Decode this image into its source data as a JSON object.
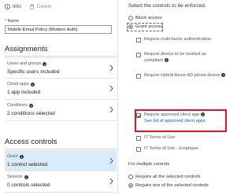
{
  "toolbar": {
    "info_label": "Info",
    "delete_label": "Delete"
  },
  "name_field": {
    "label": "Name",
    "required_mark": "*",
    "value": "Mobile Email Policy (Modern Auth)"
  },
  "assignments": {
    "title": "Assignments",
    "cards": [
      {
        "label": "Users and groups",
        "value": "Specific users included"
      },
      {
        "label": "Cloud apps",
        "value": "1 app included"
      },
      {
        "label": "Conditions",
        "value": "2 conditions selected"
      }
    ]
  },
  "access_controls": {
    "title": "Access controls",
    "cards": [
      {
        "label": "Grant",
        "value": "1 control selected"
      },
      {
        "label": "Session",
        "value": "0 controls selected"
      }
    ]
  },
  "grant_panel": {
    "instruction": "Select the controls to be enforced.",
    "access_options": [
      {
        "label": "Block access",
        "selected": false
      },
      {
        "label": "Grant access",
        "selected": true
      }
    ],
    "controls": [
      {
        "label": "Require multi-factor authentication",
        "checked": false
      },
      {
        "label": "Require device to be marked as compliant",
        "checked": false
      },
      {
        "label": "Require Hybrid Azure AD joined device",
        "checked": false
      },
      {
        "label": "Require approved client app",
        "checked": true,
        "link": "See list of approved client apps"
      },
      {
        "label": "IT Terms of Use",
        "checked": false
      },
      {
        "label": "IT Terms of Use - Employee",
        "checked": false
      }
    ],
    "multiple_label": "For multiple controls",
    "multiple_options": [
      {
        "label": "Require all the selected controls",
        "selected": false
      },
      {
        "label": "Require one of the selected controls",
        "selected": true
      }
    ]
  },
  "colors": {
    "selected_card_bg": "#d9ebf9",
    "highlight_border": "#e8112d",
    "link": "#0062ad"
  }
}
